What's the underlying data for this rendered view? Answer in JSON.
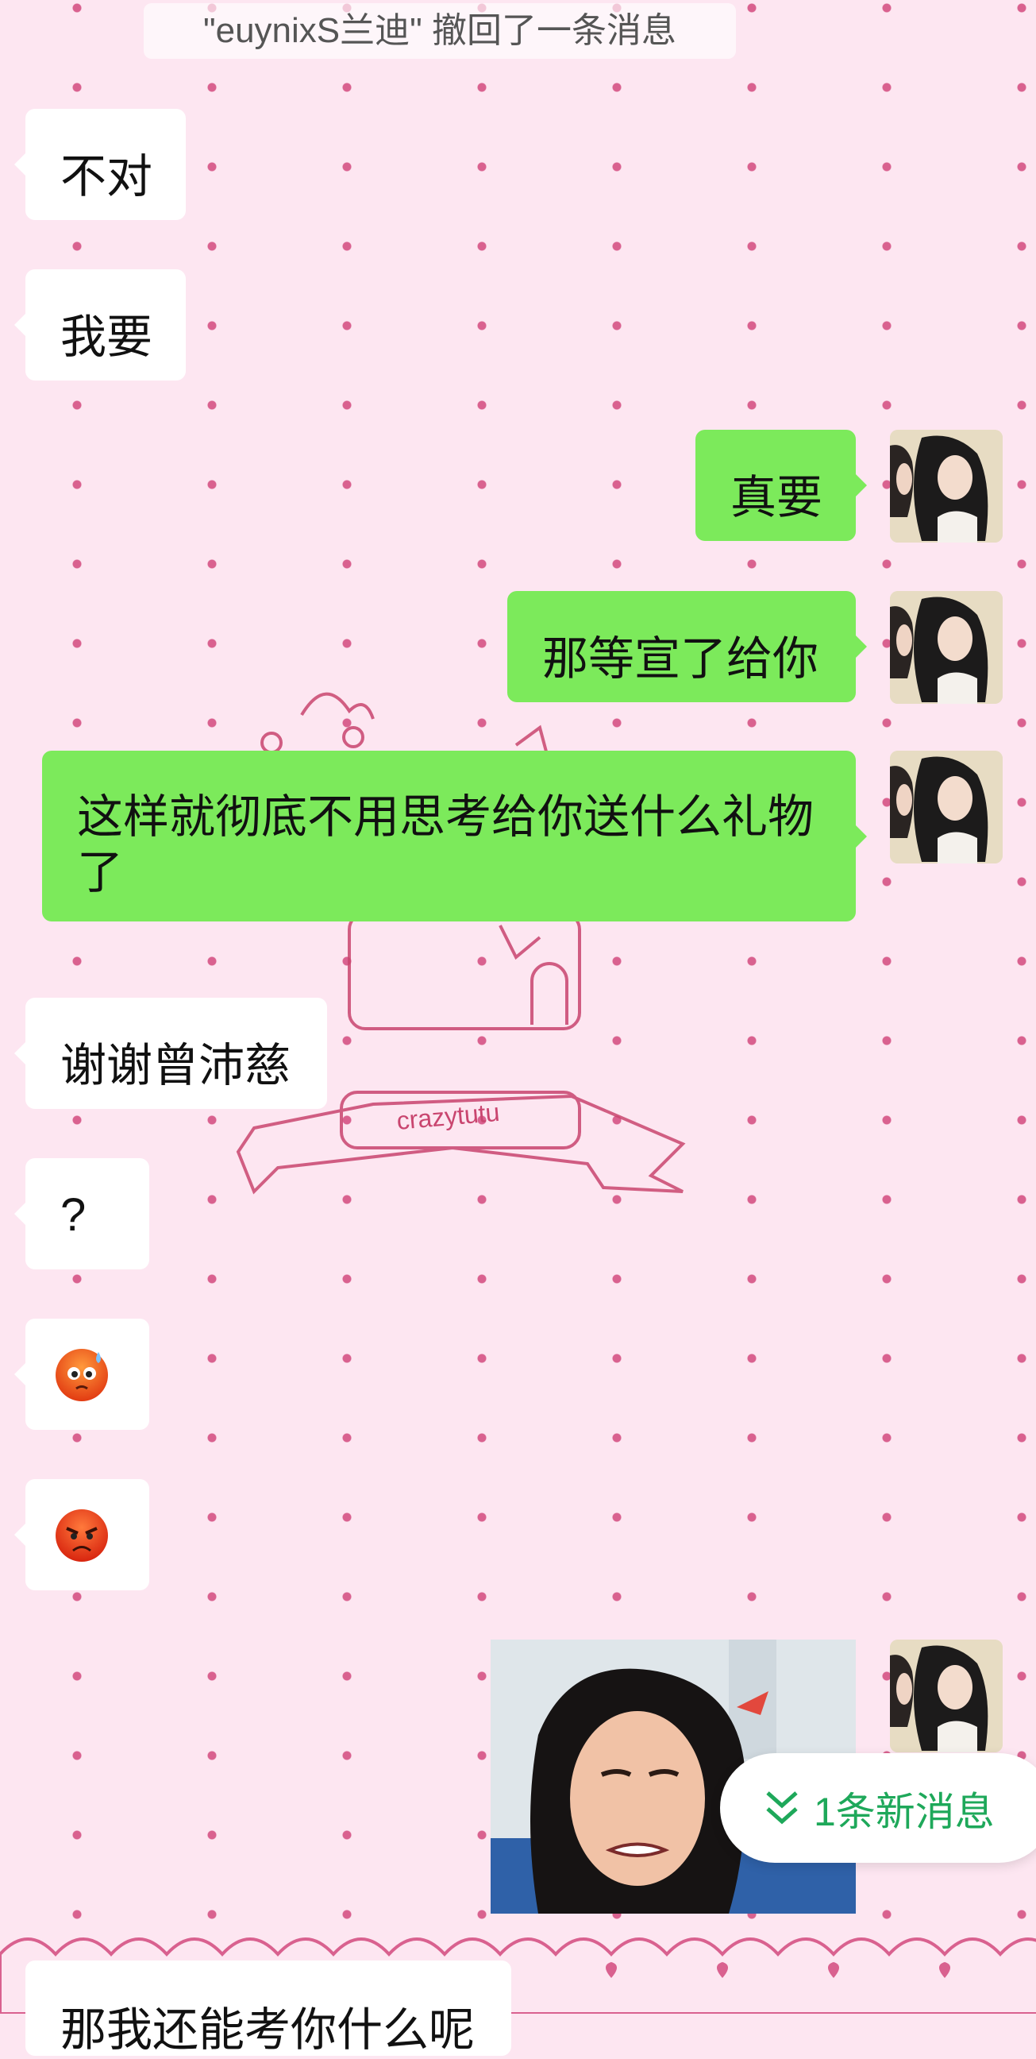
{
  "system_notice": "\"euynixS兰迪\" 撤回了一条消息",
  "messages": [
    {
      "side": "left",
      "text": "不对"
    },
    {
      "side": "left",
      "text": "我要"
    },
    {
      "side": "right",
      "text": "真要"
    },
    {
      "side": "right",
      "text": "那等宣了给你"
    },
    {
      "side": "right",
      "text": "这样就彻底不用思考给你送什么礼物",
      "text2": "了"
    },
    {
      "side": "left",
      "text": "谢谢曾沛慈"
    },
    {
      "side": "left",
      "text": "?"
    },
    {
      "side": "left",
      "emoji": "sweat-face-emoji"
    },
    {
      "side": "left",
      "emoji": "angry-face-emoji"
    },
    {
      "side": "right",
      "image": "grimacing-woman-photo"
    },
    {
      "side": "left",
      "text": "那我还能考你什么呢"
    }
  ],
  "background_watermark": "crazytutu",
  "new_message_button": {
    "label": "1条新消息",
    "icon": "double-chevron-down-icon"
  },
  "colors": {
    "bg": "#fde6f1",
    "dot": "#d9618f",
    "my_bubble": "#7cea5b",
    "new_msg_text": "#1ea85a"
  }
}
